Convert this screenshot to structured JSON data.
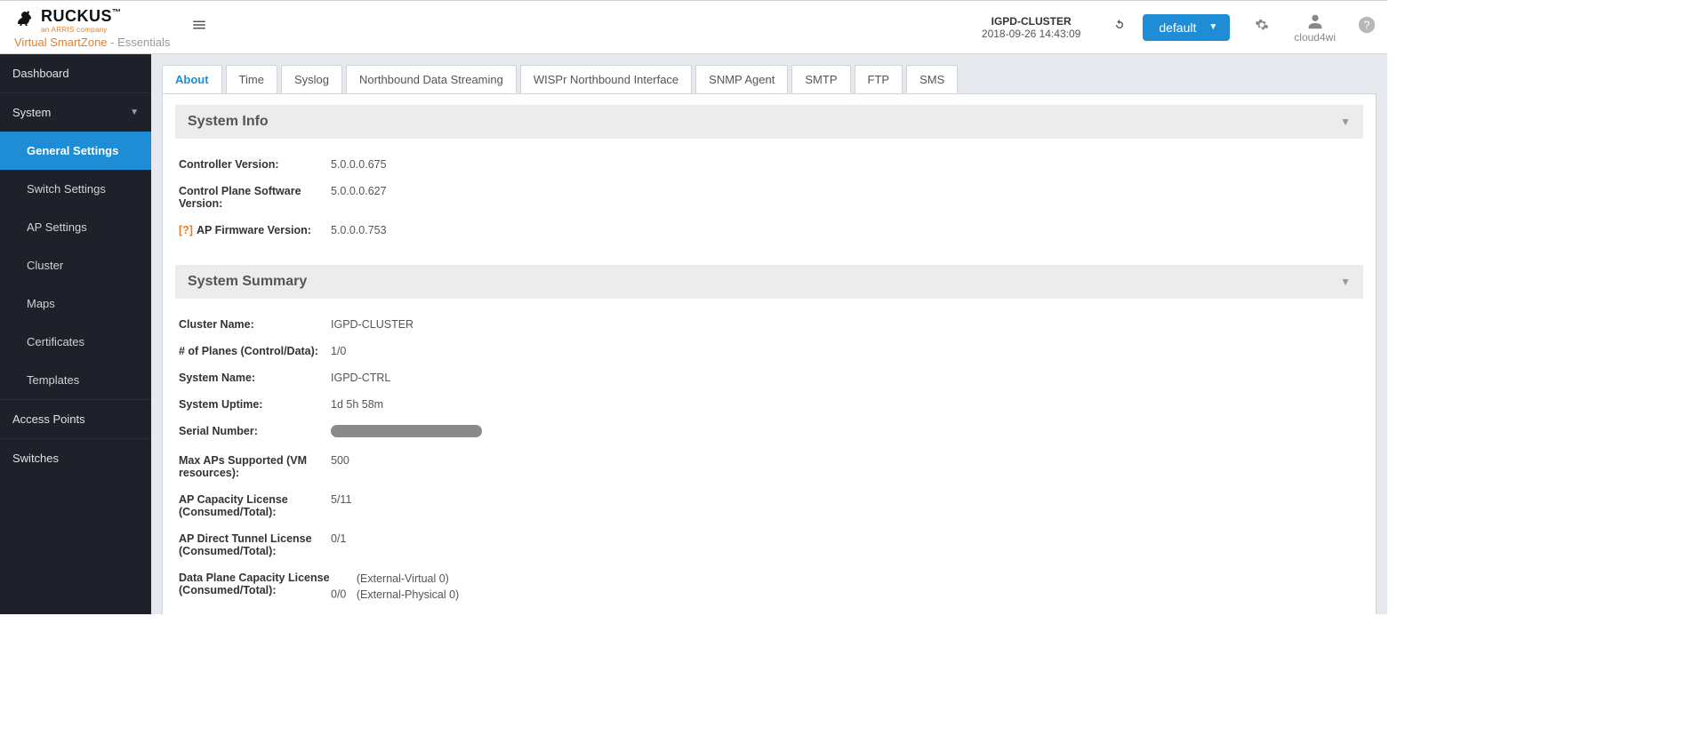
{
  "brand": {
    "name": "RUCKUS",
    "tagline": "an ARRIS company",
    "product": "Virtual SmartZone",
    "edition": "Essentials"
  },
  "header": {
    "cluster_name": "IGPD-CLUSTER",
    "timestamp": "2018-09-26  14:43:09",
    "default_label": "default",
    "username": "cloud4wi"
  },
  "sidebar": {
    "dashboard": "Dashboard",
    "system": "System",
    "system_children": {
      "general_settings": "General Settings",
      "switch_settings": "Switch Settings",
      "ap_settings": "AP Settings",
      "cluster": "Cluster",
      "maps": "Maps",
      "certificates": "Certificates",
      "templates": "Templates"
    },
    "access_points": "Access Points",
    "switches": "Switches"
  },
  "tabs": {
    "about": "About",
    "time": "Time",
    "syslog": "Syslog",
    "northbound": "Northbound Data Streaming",
    "wispr": "WISPr Northbound Interface",
    "snmp": "SNMP Agent",
    "smtp": "SMTP",
    "ftp": "FTP",
    "sms": "SMS"
  },
  "system_info": {
    "title": "System Info",
    "rows": {
      "controller_version_label": "Controller Version:",
      "controller_version_value": "5.0.0.0.675",
      "cp_version_label": "Control Plane Software Version:",
      "cp_version_value": "5.0.0.0.627",
      "ap_fw_label": "AP Firmware Version:",
      "ap_fw_value": "5.0.0.0.753",
      "help_marker": "[?]"
    }
  },
  "system_summary": {
    "title": "System Summary",
    "rows": {
      "cluster_name_label": "Cluster Name:",
      "cluster_name_value": "IGPD-CLUSTER",
      "planes_label": "# of Planes (Control/Data):",
      "planes_value": "1/0",
      "system_name_label": "System Name:",
      "system_name_value": "IGPD-CTRL",
      "uptime_label": "System Uptime:",
      "uptime_value": "1d 5h 58m",
      "serial_label": "Serial Number:",
      "max_aps_label": "Max APs Supported (VM resources):",
      "max_aps_value": "500",
      "ap_cap_label": "AP Capacity License (Consumed/Total):",
      "ap_cap_value": "5/11",
      "ap_tunnel_label": "AP Direct Tunnel License (Consumed/Total):",
      "ap_tunnel_value": "0/1",
      "dp_label": "Data Plane Capacity License (Consumed/Total):",
      "dp_value": "0/0",
      "dp_ext_virtual": "(External-Virtual      0)",
      "dp_ext_physical": "(External-Physical    0)"
    }
  }
}
